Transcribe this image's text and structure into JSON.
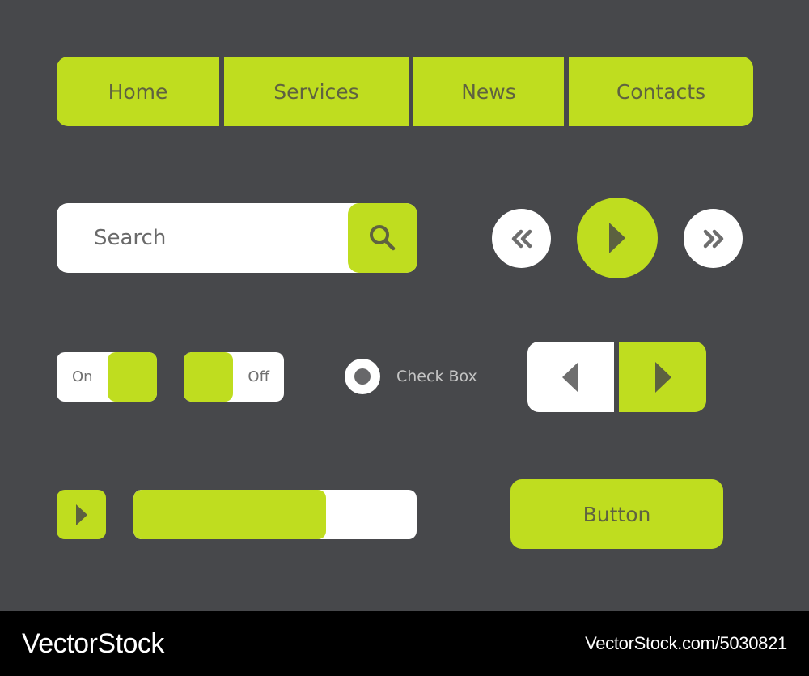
{
  "colors": {
    "background": "#47484b",
    "accent": "#bfdd1f",
    "accent_text": "#5f6240",
    "surface": "#ffffff",
    "footer": "#000000"
  },
  "nav": {
    "items": [
      {
        "label": "Home"
      },
      {
        "label": "Services"
      },
      {
        "label": "News"
      },
      {
        "label": "Contacts"
      }
    ]
  },
  "search": {
    "placeholder": "Search",
    "icon": "search-icon"
  },
  "media": {
    "rewind_icon": "double-chevron-left-icon",
    "play_icon": "play-icon",
    "forward_icon": "double-chevron-right-icon"
  },
  "toggles": [
    {
      "label": "On",
      "state": "on"
    },
    {
      "label": "Off",
      "state": "off"
    }
  ],
  "radio": {
    "label": "Check Box",
    "checked": true
  },
  "pager": {
    "prev_icon": "triangle-left-icon",
    "next_icon": "triangle-right-icon"
  },
  "progress": {
    "play_icon": "play-icon",
    "value_percent": 68
  },
  "button": {
    "label": "Button"
  },
  "footer": {
    "brand": "VectorStock",
    "url": "VectorStock.com/5030821"
  }
}
